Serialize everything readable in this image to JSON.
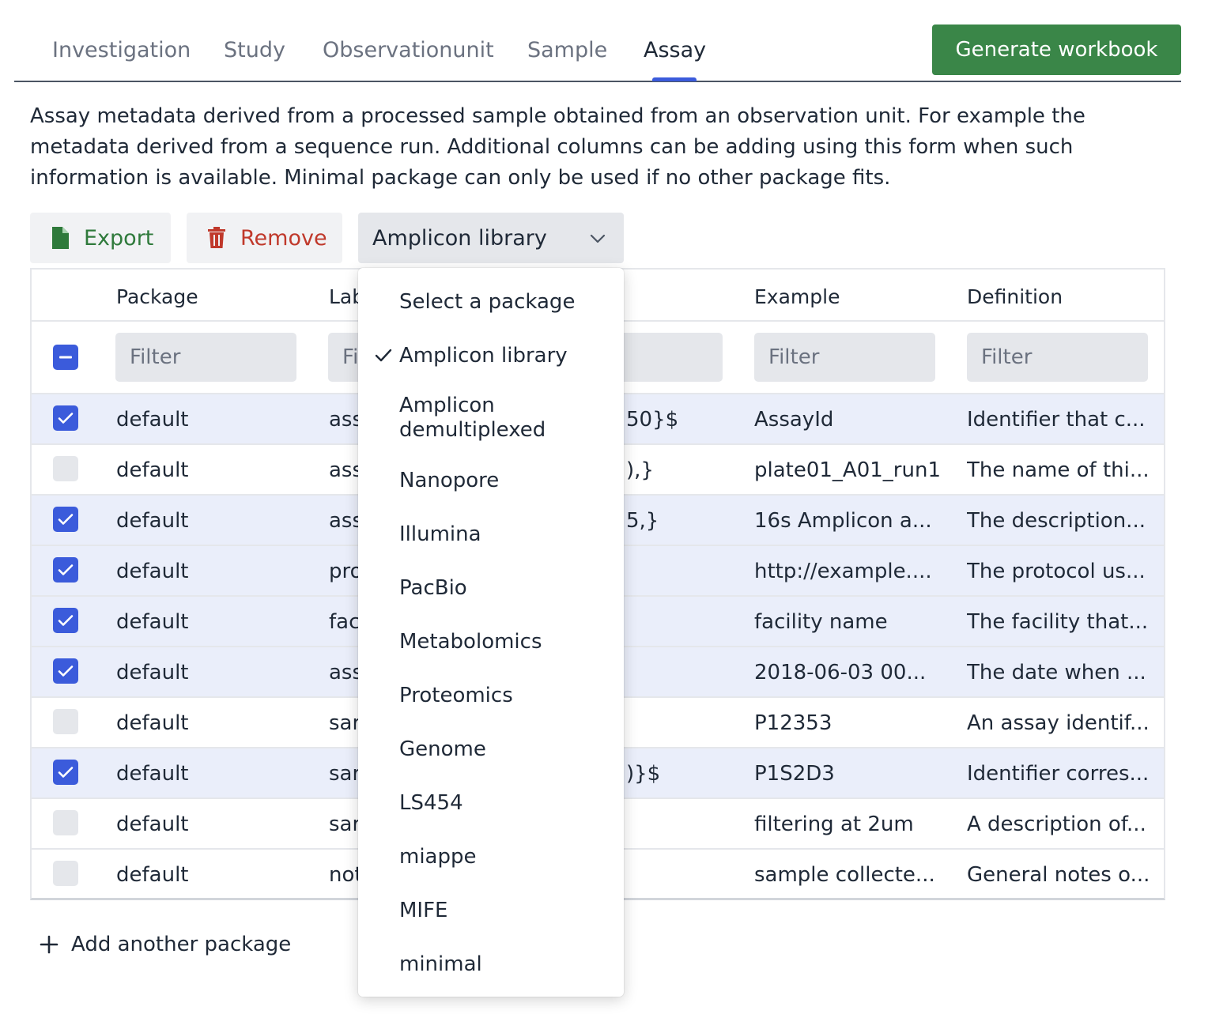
{
  "tabs": [
    "Investigation",
    "Study",
    "Observationunit",
    "Sample",
    "Assay"
  ],
  "active_tab": "Assay",
  "generate_button": "Generate workbook",
  "description": "Assay metadata derived from a processed sample obtained from an observation unit. For example the metadata derived from a sequence run. Additional columns can be adding using this form when such information is available. Minimal package can only be used if no other package fits.",
  "toolbar": {
    "export_label": "Export",
    "remove_label": "Remove",
    "selected_package": "Amplicon library"
  },
  "table": {
    "headers": {
      "package": "Package",
      "label": "Lab",
      "example": "Example",
      "definition": "Definition"
    },
    "filters": {
      "package": "Filter",
      "label": "Fi",
      "example": "Filter",
      "definition": "Filter"
    },
    "rows": [
      {
        "checked": true,
        "package": "default",
        "label": "ass",
        "syntax": "50}$",
        "example": "AssayId",
        "definition": "Identifier that c..."
      },
      {
        "checked": false,
        "package": "default",
        "label": "ass",
        "syntax": "),}",
        "example": "plate01_A01_run1",
        "definition": "The name of thi..."
      },
      {
        "checked": true,
        "package": "default",
        "label": "ass",
        "syntax": "5,}",
        "example": "16s Amplicon a...",
        "definition": "The description..."
      },
      {
        "checked": true,
        "package": "default",
        "label": "pro",
        "syntax": "",
        "example": "http://example....",
        "definition": "The protocol us..."
      },
      {
        "checked": true,
        "package": "default",
        "label": "fac",
        "syntax": "",
        "example": "facility name",
        "definition": "The facility that..."
      },
      {
        "checked": true,
        "package": "default",
        "label": "ass",
        "syntax": "",
        "example": "2018-06-03 00...",
        "definition": "The date when ..."
      },
      {
        "checked": false,
        "package": "default",
        "label": "sar",
        "syntax": "",
        "example": "P12353",
        "definition": "An assay identif..."
      },
      {
        "checked": true,
        "package": "default",
        "label": "sar",
        "syntax": ")}$",
        "example": "P1S2D3",
        "definition": "Identifier corres..."
      },
      {
        "checked": false,
        "package": "default",
        "label": "sar",
        "syntax": "",
        "example": "filtering at 2um",
        "definition": "A description of..."
      },
      {
        "checked": false,
        "package": "default",
        "label": "not",
        "syntax": "",
        "example": "sample collecte...",
        "definition": "General notes o..."
      }
    ]
  },
  "add_package_label": "Add another package",
  "dropdown": {
    "options": [
      "Select a package",
      "Amplicon library",
      "Amplicon demultiplexed",
      "Nanopore",
      "Illumina",
      "PacBio",
      "Metabolomics",
      "Proteomics",
      "Genome",
      "LS454",
      "miappe",
      "MIFE",
      "minimal"
    ],
    "selected": "Amplicon library"
  },
  "colors": {
    "accent": "#3b5bdb",
    "generate_green": "#3a8648",
    "export_green": "#2f7a3b",
    "remove_red": "#c0392b",
    "selected_row": "#eaeefa"
  }
}
